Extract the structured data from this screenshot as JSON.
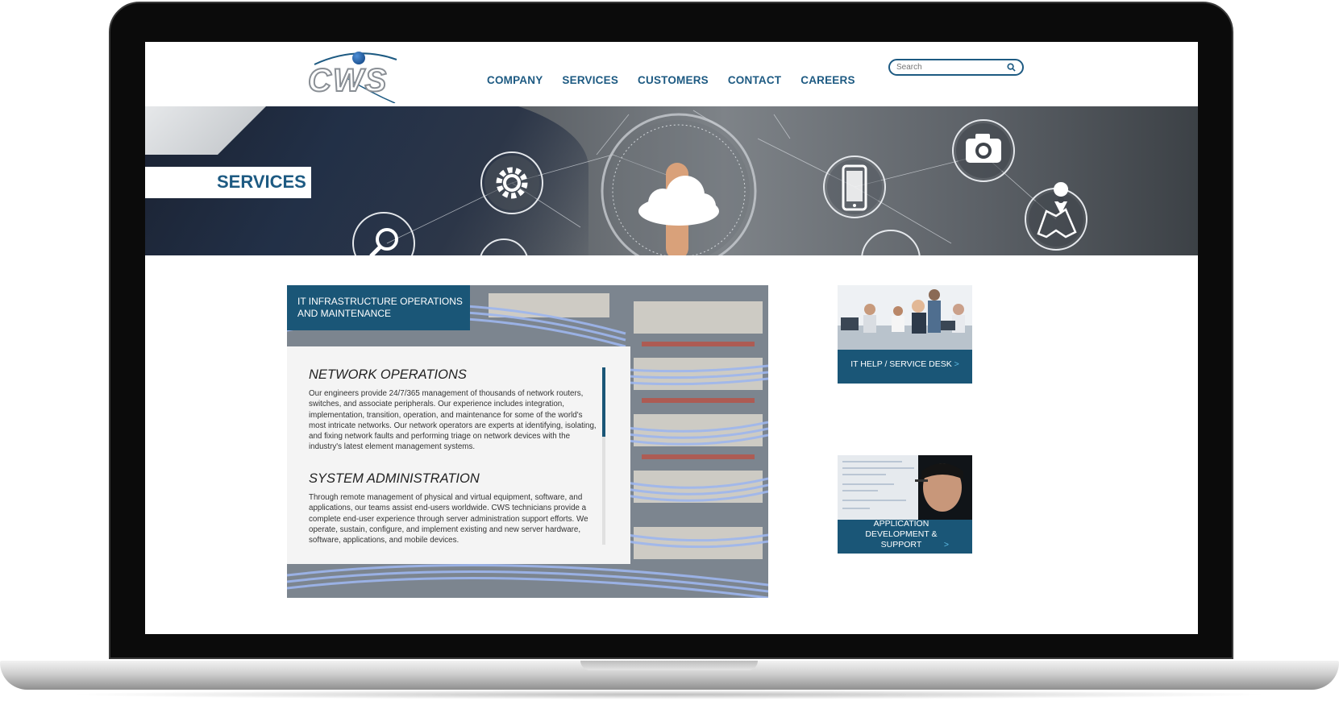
{
  "header": {
    "logo_text": "CWS",
    "nav": [
      "COMPANY",
      "SERVICES",
      "CUSTOMERS",
      "CONTACT",
      "CAREERS"
    ],
    "search_placeholder": "Search"
  },
  "hero": {
    "title": "SERVICES"
  },
  "feature": {
    "label": "IT INFRASTRUCTURE OPERATIONS\nAND MAINTENANCE",
    "sections": [
      {
        "heading": "NETWORK OPERATIONS",
        "body": "Our engineers provide 24/7/365 management of thousands of network routers, switches, and associate peripherals.  Our experience includes integration, implementation, transition, operation, and maintenance for some of the world's most intricate networks. Our network operators are experts at identifying, isolating, and fixing network faults and performing triage on network devices with the industry's latest element management systems."
      },
      {
        "heading": "SYSTEM ADMINISTRATION",
        "body": "Through remote management of physical and virtual equipment, software, and applications, our teams assist end-users worldwide.  CWS technicians provide a complete end-user experience through server administration support efforts. We operate, sustain, configure, and implement existing and new server hardware, software, applications, and mobile devices."
      }
    ]
  },
  "sidebar": {
    "cards": [
      {
        "label": "IT HELP / SERVICE DESK",
        "arrow": ">"
      },
      {
        "label": "APPLICATION DEVELOPMENT & SUPPORT",
        "arrow": ">"
      }
    ]
  },
  "colors": {
    "brand_blue": "#1d5a82",
    "panel_blue": "#1a5677",
    "link_arrow": "#5fc0ea"
  },
  "icons": [
    "gear-icon",
    "search-icon",
    "cloud-icon",
    "phone-icon",
    "camera-icon",
    "map-pin-icon"
  ]
}
